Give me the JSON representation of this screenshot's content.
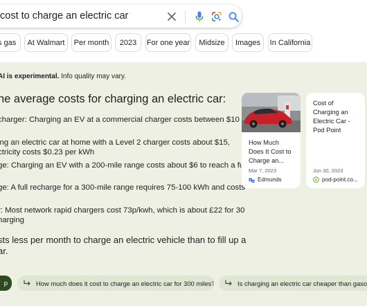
{
  "search": {
    "query": "cost to charge an electric car"
  },
  "chips": [
    "'s gas",
    "At Walmart",
    "Per month",
    "2023",
    "For one year",
    "Midsize",
    "Images",
    "In California"
  ],
  "ai": {
    "note_bold": "AI is experimental.",
    "note_rest": " Info quality may vary.",
    "heading": "ne average costs for charging an electric car:",
    "lines": [
      "charger: Charging an EV at a commercial charger costs between $10",
      "ing an electric car at home with a Level 2 charger costs about $15,",
      "ctricity costs $0.23 per kWh",
      "ge: Charging an EV with a 200-mile range costs about $6 to reach a full",
      "ge: A full recharge for a 300-mile range requires 75-100 kWh and costs",
      "r: Most network rapid chargers cost 73p/kwh, which is about £22 for 30",
      "harging"
    ],
    "summary": [
      "sts less per month to charge an electric vehicle than to fill up a",
      "ar."
    ]
  },
  "cards": [
    {
      "title": "How Much Does It Cost to Charge an...",
      "title_lines": [
        "How Much",
        "Does It Cost to",
        "Charge an..."
      ],
      "date": "Mar 7, 2023",
      "site": "Edmunds",
      "site_color": "#2f6fde"
    },
    {
      "title_lines": [
        "Cost of",
        "Charging an",
        "Electric Car -",
        "Pod Point"
      ],
      "date": "Jun 30, 2023",
      "site": "pod-point.co...",
      "site_color": "#7cb342"
    }
  ],
  "followups": {
    "main_label": "p",
    "items": [
      "How much does it cost to charge an electric car for 300 miles?",
      "Is charging an electric car cheaper than gasoline?"
    ]
  },
  "colors": {
    "panel_bg": "#edf0e2",
    "followup_bg": "#dfe6d1",
    "followup_primary": "#2d4a20"
  },
  "icons": {
    "clear": "close-icon",
    "mic": "microphone-icon",
    "lens": "google-lens-icon",
    "search": "search-icon",
    "followup": "arrow-return-icon"
  }
}
